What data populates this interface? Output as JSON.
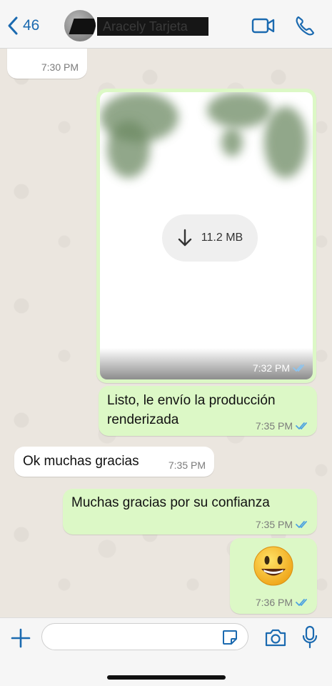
{
  "header": {
    "back_count": "46",
    "contact_name": "Aracely Tarjeta"
  },
  "messages": [
    {
      "id": "m0",
      "direction": "incoming",
      "type": "sticker-partial",
      "time": "7:30 PM"
    },
    {
      "id": "m1",
      "direction": "outgoing",
      "type": "image",
      "download_size": "11.2 MB",
      "time": "7:32 PM",
      "read": true
    },
    {
      "id": "m2",
      "direction": "outgoing",
      "type": "text",
      "text": "Listo, le envío la producción renderizada",
      "time": "7:35 PM",
      "read": true
    },
    {
      "id": "m3",
      "direction": "incoming",
      "type": "text",
      "text": "Ok muchas gracias",
      "time": "7:35 PM"
    },
    {
      "id": "m4",
      "direction": "outgoing",
      "type": "text",
      "text": "Muchas gracias por su confianza",
      "time": "7:35 PM",
      "read": true
    },
    {
      "id": "m5",
      "direction": "outgoing",
      "type": "emoji",
      "text": "😃",
      "time": "7:36 PM",
      "read": true
    }
  ],
  "composer": {
    "placeholder": "",
    "value": ""
  },
  "icons": {
    "back": "chevron-left-icon",
    "video": "video-camera-icon",
    "call": "phone-icon",
    "plus": "plus-icon",
    "sticker": "sticker-icon",
    "camera": "camera-icon",
    "mic": "microphone-icon",
    "download": "download-arrow-icon",
    "read_receipt": "double-check-icon"
  },
  "colors": {
    "accent": "#1b6ab0",
    "outgoing_bubble": "#dcf8c6",
    "incoming_bubble": "#ffffff",
    "read_ticks": "#4fa3e0",
    "chat_background": "#ebe6df"
  }
}
